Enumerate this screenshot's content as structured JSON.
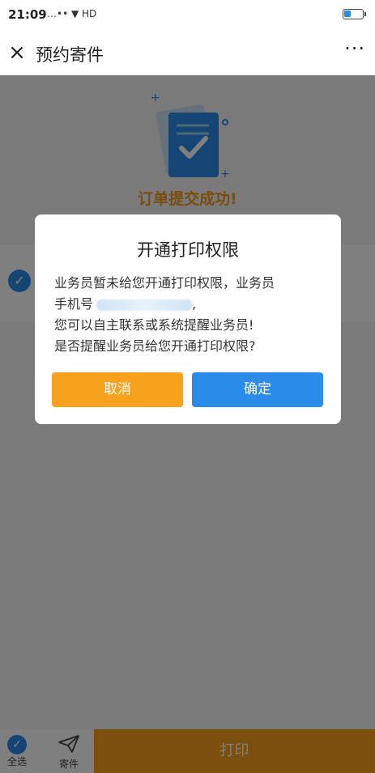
{
  "status_bar": {
    "time": "21:09",
    "signal_text": "…•• ▼ HD"
  },
  "nav": {
    "close_label": "×",
    "title": "预约寄件",
    "more_label": "···"
  },
  "battery": {
    "level": 0.35
  },
  "page": {
    "success_text": "订单提交成功!",
    "card_check": "✓"
  },
  "bottom_bar": {
    "select_all": "全选",
    "send": "寄件",
    "print": "打印",
    "select_check": "✓"
  },
  "dialog": {
    "title": "开通打印权限",
    "line1": "业务员暂未给您开通打印权限，业务员",
    "line2_prefix": "手机号",
    "line2_suffix": ",",
    "line3": "您可以自主联系或系统提醒业务员!",
    "line4": "是否提醒业务员给您开通打印权限?",
    "cancel": "取消",
    "confirm": "确定"
  },
  "colors": {
    "accent_blue": "#2a8be8",
    "accent_orange": "#f7a11c",
    "overlay": "rgba(0,0,0,0.5)"
  }
}
